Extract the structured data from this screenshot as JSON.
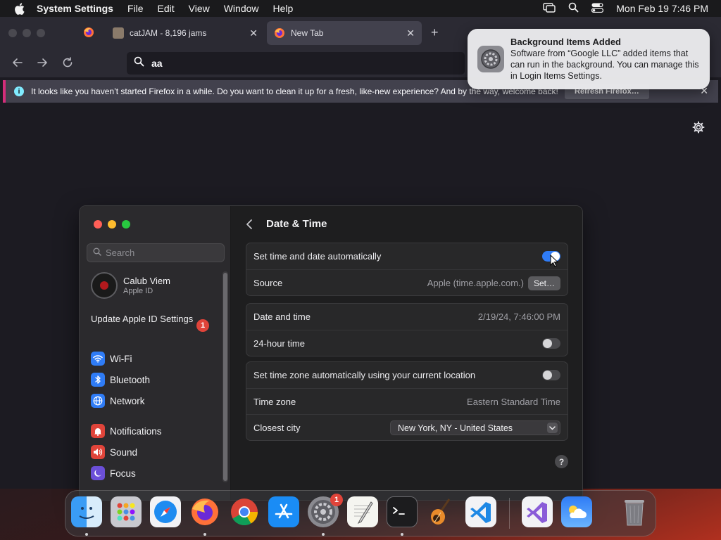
{
  "menubar": {
    "app_name": "System Settings",
    "menus": [
      "File",
      "Edit",
      "View",
      "Window",
      "Help"
    ],
    "clock": "Mon Feb 19  7:46 PM"
  },
  "firefox": {
    "tabs": [
      {
        "title": "catJAM - 8,196 jams"
      },
      {
        "title": "New Tab"
      }
    ],
    "new_tab_label": "+",
    "url": "aa",
    "infobar": {
      "message": "It looks like you haven’t started Firefox in a while. Do you want to clean it up for a fresh, like-new experience? And by the way, welcome back!",
      "button": "Refresh Firefox…",
      "close": "✕"
    }
  },
  "notification": {
    "title": "Background Items Added",
    "body": "Software from “Google LLC” added items that can run in the background. You can manage this in Login Items Settings."
  },
  "settings": {
    "sidebar": {
      "search_placeholder": "Search",
      "account_name": "Calub Viem",
      "account_sub": "Apple ID",
      "update_label": "Update Apple ID Settings",
      "update_badge": "1",
      "items": [
        {
          "label": "Wi-Fi",
          "color": "#2f7cf6"
        },
        {
          "label": "Bluetooth",
          "color": "#2f7cf6"
        },
        {
          "label": "Network",
          "color": "#2f7cf6"
        },
        {
          "label": "Notifications",
          "color": "#e0443a"
        },
        {
          "label": "Sound",
          "color": "#e0443a"
        },
        {
          "label": "Focus",
          "color": "#6b4fd8"
        }
      ]
    },
    "page_title": "Date & Time",
    "rows": {
      "auto_time_label": "Set time and date automatically",
      "auto_time_on": true,
      "source_label": "Source",
      "source_value": "Apple (time.apple.com.)",
      "set_button": "Set…",
      "date_time_label": "Date and time",
      "date_time_value": "2/19/24, 7:46:00 PM",
      "hour24_label": "24-hour time",
      "hour24_on": false,
      "auto_tz_label": "Set time zone automatically using your current location",
      "auto_tz_on": false,
      "tz_label": "Time zone",
      "tz_value": "Eastern Standard Time",
      "city_label": "Closest city",
      "city_value": "New York, NY - United States"
    },
    "help": "?"
  },
  "dock": {
    "settings_badge": "1"
  }
}
